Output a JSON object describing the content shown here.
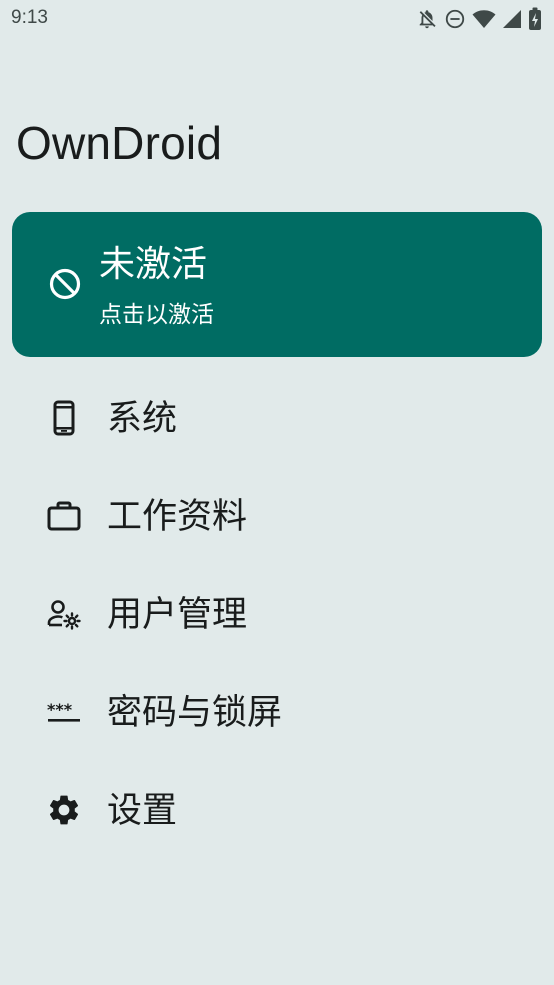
{
  "status_bar": {
    "time": "9:13",
    "icons": [
      "notifications-off-icon",
      "do-not-disturb-icon",
      "wifi-icon",
      "cellular-signal-icon",
      "battery-charging-icon"
    ]
  },
  "app": {
    "title": "OwnDroid"
  },
  "activation_card": {
    "icon": "block-icon",
    "title": "未激活",
    "subtitle": "点击以激活",
    "color": "#006c63"
  },
  "menu": {
    "items": [
      {
        "icon": "smartphone-icon",
        "label": "系统"
      },
      {
        "icon": "work-briefcase-icon",
        "label": "工作资料"
      },
      {
        "icon": "manage-accounts-icon",
        "label": "用户管理"
      },
      {
        "icon": "password-icon",
        "label": "密码与锁屏"
      },
      {
        "icon": "settings-gear-icon",
        "label": "设置"
      }
    ]
  },
  "colors": {
    "background": "#e1eaea",
    "text": "#191c1c",
    "accent": "#006c63"
  }
}
